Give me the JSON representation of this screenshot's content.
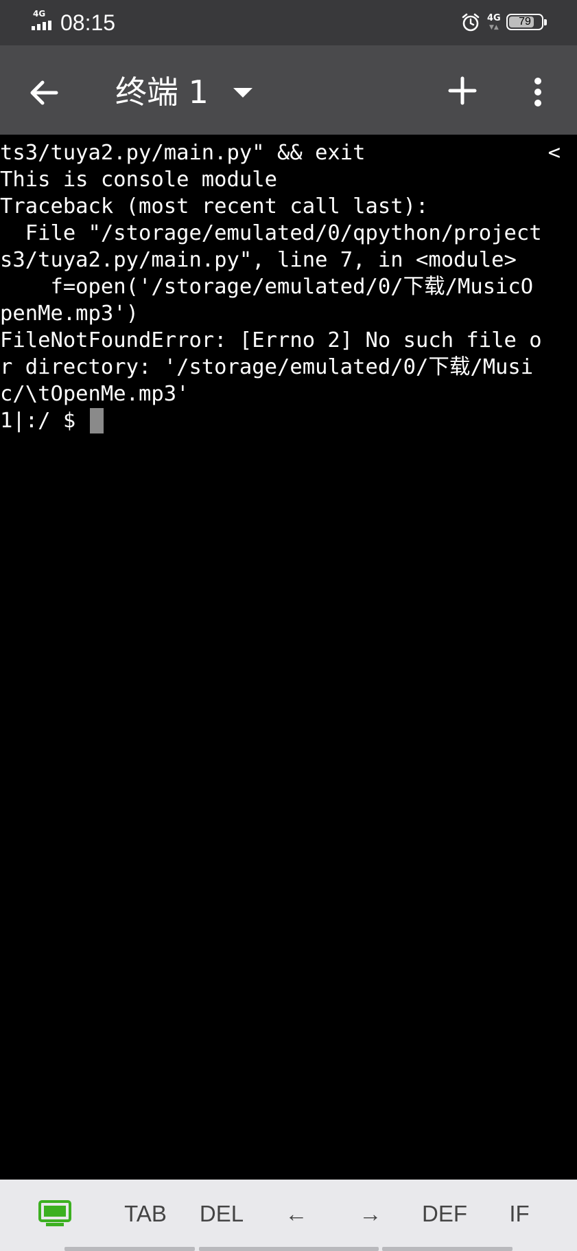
{
  "status_bar": {
    "network_type": "4G",
    "time": "08:15",
    "network_type_2": "4G",
    "battery_percent": "79",
    "battery_level": 0.79,
    "icons": [
      "signal-icon",
      "alarm-icon",
      "battery-icon"
    ]
  },
  "app_bar": {
    "title": "终端 1",
    "icons": [
      "back-arrow-icon",
      "dropdown-triangle-icon",
      "plus-icon",
      "more-vert-icon"
    ]
  },
  "terminal": {
    "scroll_indicator": "<",
    "lines": [
      "ts3/tuya2.py/main.py\" && exit",
      "This is console module",
      "Traceback (most recent call last):",
      "  File \"/storage/emulated/0/qpython/project",
      "s3/tuya2.py/main.py\", line 7, in <module>",
      "    f=open('/storage/emulated/0/下载/MusicO",
      "penMe.mp3')",
      "FileNotFoundError: [Errno 2] No such file o",
      "r directory: '/storage/emulated/0/下载/Musi",
      "c/\\tOpenMe.mp3'"
    ],
    "prompt": "1|:/ $ "
  },
  "extra_keys": {
    "keyboard_icon": "keyboard-toggle-icon",
    "accent_color": "#3cb021",
    "keys": [
      "TAB",
      "DEL",
      "←",
      "→",
      "DEF",
      "IF"
    ]
  }
}
